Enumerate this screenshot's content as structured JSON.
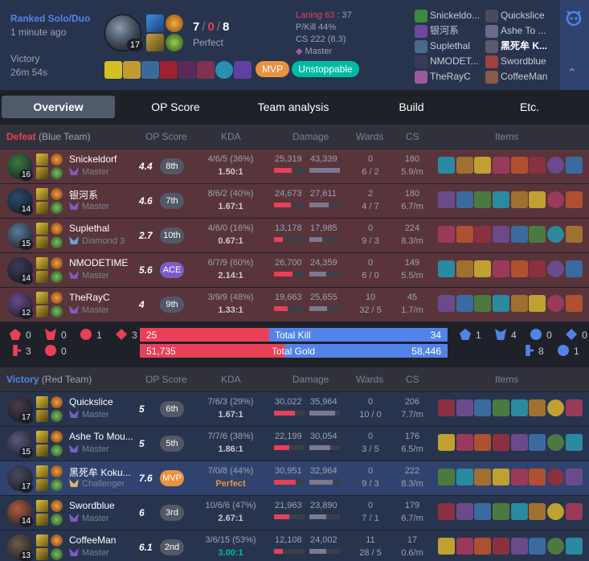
{
  "header": {
    "queue": "Ranked Solo/Duo",
    "time_ago": "1 minute ago",
    "result": "Victory",
    "duration": "26m 54s",
    "champ_level": "17",
    "kills": "7",
    "deaths": "0",
    "assists": "8",
    "kda_label": "Perfect",
    "laning_label": "Laning 63",
    "laning_score": "37",
    "pkill": "P/Kill 44%",
    "cs": "CS 222 (8.3)",
    "tier": "Master",
    "mvp_badge": "MVP",
    "badge2": "Unstoppable",
    "roster_left": [
      "Snickeldo...",
      "银河系",
      "Suplethal",
      "NMODET...",
      "TheRayC"
    ],
    "roster_right": [
      "Quickslice",
      "Ashe To ...",
      "黑死牟 K...",
      "Swordblue",
      "CoffeeMan"
    ]
  },
  "tabs": [
    "Overview",
    "OP Score",
    "Team analysis",
    "Build",
    "Etc."
  ],
  "columns": {
    "op": "OP Score",
    "kda": "KDA",
    "damage": "Damage",
    "wards": "Wards",
    "cs": "CS",
    "items": "Items"
  },
  "teams": [
    {
      "result": "Defeat",
      "side": "(Blue Team)",
      "players": [
        {
          "name": "Snickeldorf",
          "tier": "Master",
          "level": "16",
          "op": "4.4",
          "rank": "8th",
          "kda": "4/6/5 (36%)",
          "ratio": "1.50:1",
          "dmg": "25,319",
          "taken": "43,339",
          "dmg_frac": 0.58,
          "taken_frac": 1.0,
          "wards": "0",
          "wards2": "6 / 2",
          "cs": "160",
          "csm": "5.9/m"
        },
        {
          "name": "银河系",
          "tier": "Master",
          "level": "14",
          "op": "4.6",
          "rank": "7th",
          "kda": "8/6/2 (40%)",
          "ratio": "1.67:1",
          "dmg": "24,673",
          "taken": "27,611",
          "dmg_frac": 0.56,
          "taken_frac": 0.64,
          "wards": "2",
          "wards2": "4 / 7",
          "cs": "180",
          "csm": "6.7/m"
        },
        {
          "name": "Suplethal",
          "tier": "Diamond 3",
          "level": "15",
          "op": "2.7",
          "rank": "10th",
          "kda": "4/6/0 (16%)",
          "ratio": "0.67:1",
          "dmg": "13,178",
          "taken": "17,985",
          "dmg_frac": 0.3,
          "taken_frac": 0.42,
          "wards": "0",
          "wards2": "9 / 3",
          "cs": "224",
          "csm": "8.3/m"
        },
        {
          "name": "NMODETIME",
          "tier": "Master",
          "level": "14",
          "op": "5.6",
          "rank": "ACE",
          "kda": "6/7/9 (60%)",
          "ratio": "2.14:1",
          "dmg": "26,700",
          "taken": "24,359",
          "dmg_frac": 0.61,
          "taken_frac": 0.56,
          "wards": "0",
          "wards2": "6 / 0",
          "cs": "149",
          "csm": "5.5/m"
        },
        {
          "name": "TheRayC",
          "tier": "Master",
          "level": "12",
          "op": "4",
          "rank": "9th",
          "kda": "3/9/9 (48%)",
          "ratio": "1.33:1",
          "dmg": "19,663",
          "taken": "25,655",
          "dmg_frac": 0.45,
          "taken_frac": 0.59,
          "wards": "10",
          "wards2": "32 / 5",
          "cs": "45",
          "csm": "1.7/m"
        }
      ]
    },
    {
      "result": "Victory",
      "side": "(Red Team)",
      "players": [
        {
          "name": "Quickslice",
          "tier": "Master",
          "level": "17",
          "op": "5",
          "rank": "6th",
          "kda": "7/6/3 (29%)",
          "ratio": "1.67:1",
          "dmg": "30,022",
          "taken": "35,964",
          "dmg_frac": 0.69,
          "taken_frac": 0.83,
          "wards": "0",
          "wards2": "10 / 0",
          "cs": "206",
          "csm": "7.7/m"
        },
        {
          "name": "Ashe To Mou...",
          "tier": "Master",
          "level": "15",
          "op": "5",
          "rank": "5th",
          "kda": "7/7/6 (38%)",
          "ratio": "1.86:1",
          "dmg": "22,199",
          "taken": "30,054",
          "dmg_frac": 0.51,
          "taken_frac": 0.69,
          "wards": "0",
          "wards2": "3 / 5",
          "cs": "176",
          "csm": "6.5/m"
        },
        {
          "name": "黑死牟 Koku...",
          "tier": "Challenger",
          "level": "17",
          "op": "7.6",
          "rank": "MVP",
          "kda": "7/0/8 (44%)",
          "ratio": "Perfect",
          "dmg": "30,951",
          "taken": "32,964",
          "dmg_frac": 0.71,
          "taken_frac": 0.76,
          "wards": "0",
          "wards2": "9 / 3",
          "cs": "222",
          "csm": "8.3/m"
        },
        {
          "name": "Swordblue",
          "tier": "Master",
          "level": "14",
          "op": "6",
          "rank": "3rd",
          "kda": "10/6/6 (47%)",
          "ratio": "2.67:1",
          "dmg": "21,963",
          "taken": "23,890",
          "dmg_frac": 0.51,
          "taken_frac": 0.55,
          "wards": "0",
          "wards2": "7 / 1",
          "cs": "179",
          "csm": "6.7/m"
        },
        {
          "name": "CoffeeMan",
          "tier": "Master",
          "level": "13",
          "op": "6.1",
          "rank": "2nd",
          "kda": "3/6/15 (53%)",
          "ratio": "3.00:1",
          "dmg": "12,108",
          "taken": "24,002",
          "dmg_frac": 0.28,
          "taken_frac": 0.55,
          "wards": "11",
          "wards2": "28 / 5",
          "cs": "17",
          "csm": "0.6/m"
        }
      ]
    }
  ],
  "summary": {
    "total_kill_label": "Total Kill",
    "total_gold_label": "Total Gold",
    "red_kills": "25",
    "blue_kills": "34",
    "red_gold": "51,735",
    "blue_gold": "58,446",
    "kill_frac": 0.42,
    "gold_frac": 0.47,
    "left_obj": [
      "0",
      "0",
      "1",
      "3",
      "3",
      "0"
    ],
    "right_obj": [
      "1",
      "4",
      "0",
      "0",
      "8",
      "1"
    ]
  },
  "colors": {
    "loss": "#e84057",
    "win": "#5383e8",
    "accent": "#00bba3",
    "gold": "#e89240"
  }
}
